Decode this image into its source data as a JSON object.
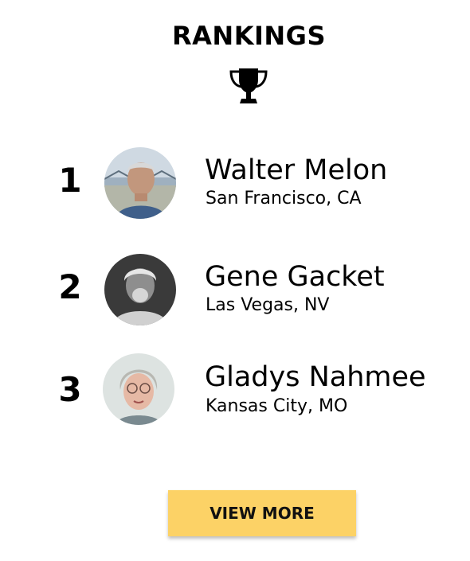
{
  "header": {
    "title": "RANKINGS",
    "icon": "trophy-icon"
  },
  "rankings": [
    {
      "rank": "1",
      "name": "Walter Melon",
      "location": "San Francisco, CA",
      "avatar": "avatar-photo"
    },
    {
      "rank": "2",
      "name": "Gene Gacket",
      "location": "Las Vegas, NV",
      "avatar": "avatar-photo"
    },
    {
      "rank": "3",
      "name": "Gladys Nahmee",
      "location": "Kansas City, MO",
      "avatar": "avatar-photo"
    }
  ],
  "actions": {
    "view_more_label": "VIEW MORE"
  },
  "colors": {
    "accent": "#fcd266",
    "text": "#000000",
    "background": "#ffffff"
  }
}
